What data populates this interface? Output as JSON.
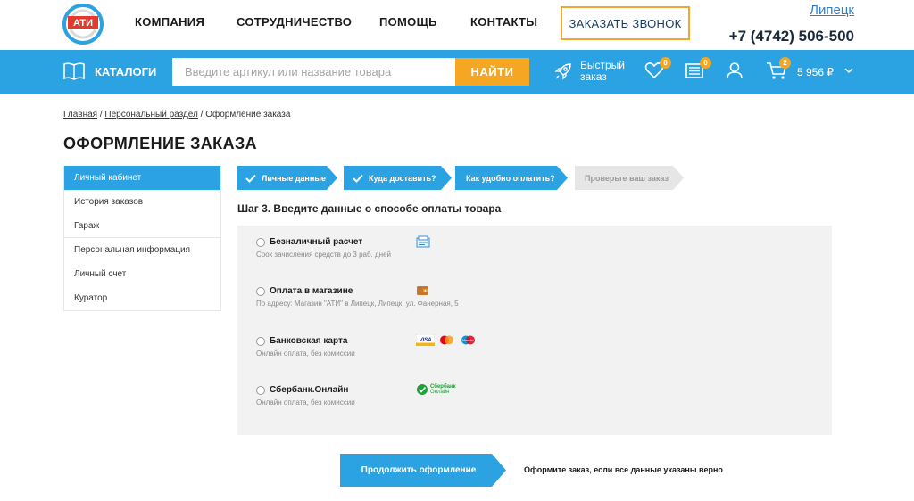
{
  "header": {
    "logo_text": "АТИ",
    "nav": [
      "КОМПАНИЯ",
      "СОТРУДНИЧЕСТВО",
      "ПОМОЩЬ",
      "КОНТАКТЫ"
    ],
    "callback_label": "ЗАКАЗАТЬ ЗВОНОК",
    "city": "Липецк",
    "phone": "+7 (4742) 506-500"
  },
  "toolbar": {
    "catalog_label": "КАТАЛОГИ",
    "search_placeholder": "Введите артикул или название товара",
    "search_button": "НАЙТИ",
    "quick_order_line1": "Быстрый",
    "quick_order_line2": "заказ",
    "favorites_count": "0",
    "compare_count": "0",
    "cart_count": "2",
    "cart_total": "5 956 ₽"
  },
  "breadcrumb": {
    "home": "Главная",
    "personal": "Персональный раздел",
    "current": "Оформление заказа",
    "separator": "/"
  },
  "page_title": "ОФОРМЛЕНИЕ ЗАКАЗА",
  "sidebar": {
    "items": [
      {
        "label": "Личный кабинет"
      },
      {
        "label": "История заказов"
      },
      {
        "label": "Гараж"
      },
      {
        "label": "Персональная информация"
      },
      {
        "label": "Личный счет"
      },
      {
        "label": "Куратор"
      }
    ]
  },
  "steps": [
    {
      "label": "Личные данные",
      "state": "done"
    },
    {
      "label": "Куда доставить?",
      "state": "done"
    },
    {
      "label": "Как удобно оплатить?",
      "state": "current"
    },
    {
      "label": "Проверьте ваш заказ",
      "state": "pending"
    }
  ],
  "step_title": "Шаг 3. Введите данные о способе оплаты товара",
  "payments": [
    {
      "name": "Безналичный расчет",
      "desc": "Срок зачисления средств до 3 раб. дней",
      "icon": "invoice-icon"
    },
    {
      "name": "Оплата в магазине",
      "desc": "По адресу: Магазин \"АТИ\" в Липецк, Липецк, ул. Фанерная, 5",
      "icon": "wallet-icon"
    },
    {
      "name": "Банковская карта",
      "desc": "Онлайн оплата, без комиссии",
      "icon": "card-icons",
      "card_labels": [
        "VISA",
        "Maestro"
      ]
    },
    {
      "name": "Сбербанк.Онлайн",
      "desc": "Онлайн оплата, без комиссии",
      "icon": "sberbank-icon",
      "logo_line1": "Сбербанк",
      "logo_line2": "Онлайн"
    }
  ],
  "continue": {
    "label": "Продолжить оформление",
    "note": "Оформите заказ, если все данные указаны верно"
  },
  "colors": {
    "primary": "#2ba2e2",
    "accent": "#f5a623",
    "step_pending": "#e6e6e6"
  }
}
